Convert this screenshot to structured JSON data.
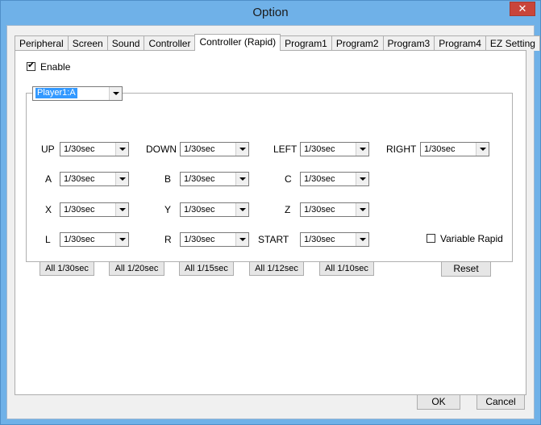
{
  "window": {
    "title": "Option"
  },
  "tabs": [
    {
      "label": "Peripheral",
      "active": false
    },
    {
      "label": "Screen",
      "active": false
    },
    {
      "label": "Sound",
      "active": false
    },
    {
      "label": "Controller",
      "active": false
    },
    {
      "label": "Controller (Rapid)",
      "active": true
    },
    {
      "label": "Program1",
      "active": false
    },
    {
      "label": "Program2",
      "active": false
    },
    {
      "label": "Program3",
      "active": false
    },
    {
      "label": "Program4",
      "active": false
    },
    {
      "label": "EZ Setting",
      "active": false
    }
  ],
  "enable": {
    "label": "Enable",
    "checked": true
  },
  "player_select": {
    "value": "Player1:A"
  },
  "buttons": [
    {
      "label": "UP",
      "value": "1/30sec"
    },
    {
      "label": "DOWN",
      "value": "1/30sec"
    },
    {
      "label": "LEFT",
      "value": "1/30sec"
    },
    {
      "label": "RIGHT",
      "value": "1/30sec"
    },
    {
      "label": "A",
      "value": "1/30sec"
    },
    {
      "label": "B",
      "value": "1/30sec"
    },
    {
      "label": "C",
      "value": "1/30sec"
    },
    {
      "label": "X",
      "value": "1/30sec"
    },
    {
      "label": "Y",
      "value": "1/30sec"
    },
    {
      "label": "Z",
      "value": "1/30sec"
    },
    {
      "label": "L",
      "value": "1/30sec"
    },
    {
      "label": "R",
      "value": "1/30sec"
    },
    {
      "label": "START",
      "value": "1/30sec"
    }
  ],
  "variable_rapid": {
    "label": "Variable Rapid",
    "checked": false
  },
  "presets": [
    "All 1/30sec",
    "All 1/20sec",
    "All 1/15sec",
    "All 1/12sec",
    "All 1/10sec"
  ],
  "reset_label": "Reset",
  "ok_label": "OK",
  "cancel_label": "Cancel"
}
